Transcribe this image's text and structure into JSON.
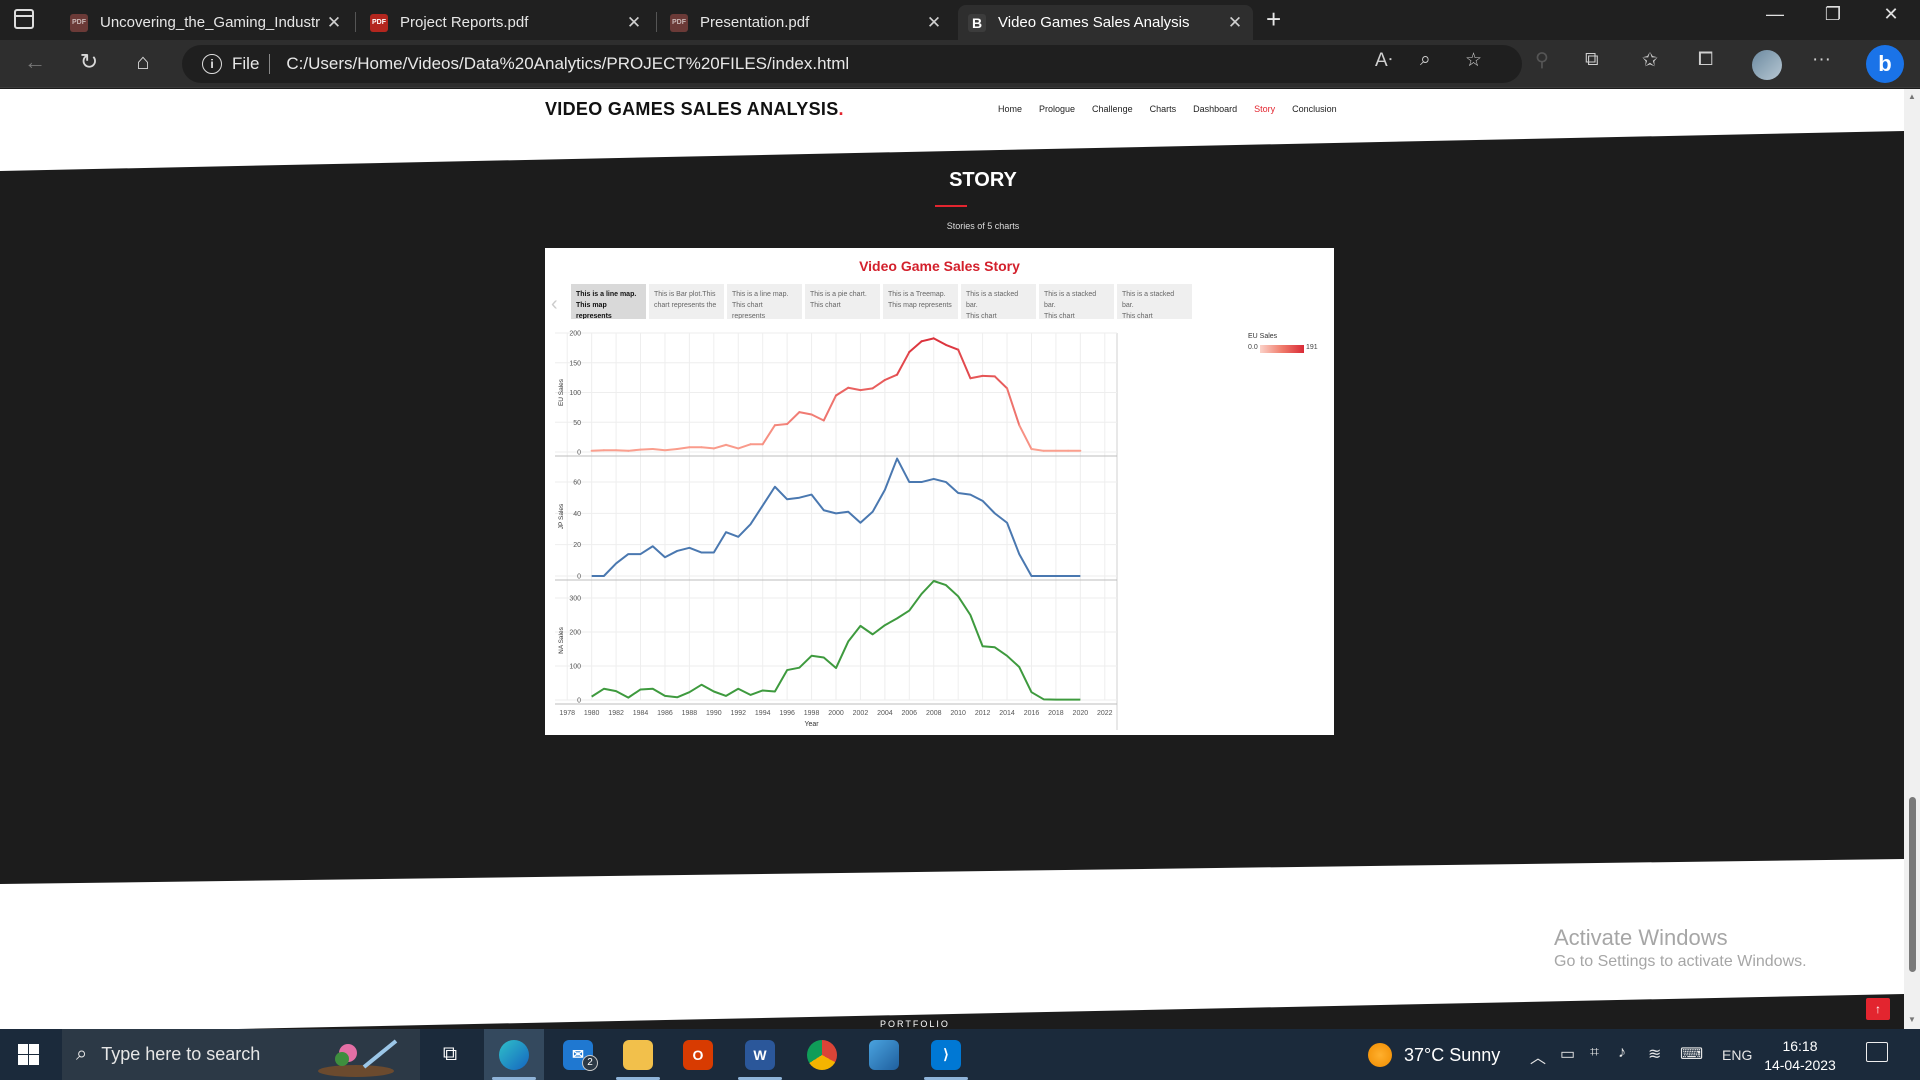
{
  "browser": {
    "tabs": [
      {
        "title": "Uncovering_the_Gaming_Industry",
        "icon": "pdf-icon"
      },
      {
        "title": "Project Reports.pdf",
        "icon": "pdf-icon"
      },
      {
        "title": "Presentation.pdf",
        "icon": "pdf-icon"
      },
      {
        "title": "Video Games Sales Analysis",
        "icon": "b-icon",
        "active": true
      }
    ],
    "new_tab_label": "+",
    "address_prefix": "File",
    "url": "C:/Users/Home/Videos/Data%20Analytics/PROJECT%20FILES/index.html",
    "bing_label": "b"
  },
  "site": {
    "brand": "VIDEO GAMES SALES ANALYSIS",
    "brand_dot": ".",
    "nav": [
      "Home",
      "Prologue",
      "Challenge",
      "Charts",
      "Dashboard",
      "Story",
      "Conclusion"
    ],
    "active_nav": "Story",
    "section_title": "STORY",
    "section_subtitle": "Stories of 5 charts",
    "footer_peek": "PORTFOLIO",
    "accent_color": "#e3252f"
  },
  "story": {
    "title": "Video Game Sales Story",
    "points": [
      {
        "line1": "This is a line map.",
        "line2": "This map represents",
        "active": true
      },
      {
        "line1": "This is Bar plot.This",
        "line2": "chart represents the"
      },
      {
        "line1": "This is a line map.",
        "line2": "This chart represents"
      },
      {
        "line1": "This is a pie chart.",
        "line2": "This chart"
      },
      {
        "line1": "This is a Treemap.",
        "line2": "This map represents"
      },
      {
        "line1": "This is a stacked bar.",
        "line2": "This chart"
      },
      {
        "line1": "This is a stacked bar.",
        "line2": "This chart"
      },
      {
        "line1": "This is a stacked bar.",
        "line2": "This chart represents"
      }
    ],
    "legend": {
      "title": "EU Sales",
      "min": "0.0",
      "max": "191"
    }
  },
  "chart_data": {
    "type": "line",
    "xlabel": "Year",
    "x": [
      1980,
      1981,
      1982,
      1983,
      1984,
      1985,
      1986,
      1987,
      1988,
      1989,
      1990,
      1991,
      1992,
      1993,
      1994,
      1995,
      1996,
      1997,
      1998,
      1999,
      2000,
      2001,
      2002,
      2003,
      2004,
      2005,
      2006,
      2007,
      2008,
      2009,
      2010,
      2011,
      2012,
      2013,
      2014,
      2015,
      2016,
      2017,
      2018,
      2019,
      2020
    ],
    "x_ticks": [
      1978,
      1980,
      1982,
      1984,
      1986,
      1988,
      1990,
      1992,
      1994,
      1996,
      1998,
      2000,
      2002,
      2004,
      2006,
      2008,
      2010,
      2012,
      2014,
      2016,
      2018,
      2020,
      2022
    ],
    "xlim": [
      1977,
      2023
    ],
    "panels": [
      {
        "name": "EU Sales",
        "ylabel": "EU Sales",
        "color": "#e0303a",
        "ylim": [
          0,
          200
        ],
        "yticks": [
          0,
          50,
          100,
          150,
          200
        ],
        "values": [
          2,
          3,
          3,
          2,
          4,
          5,
          3,
          5,
          8,
          8,
          6,
          12,
          6,
          13,
          13,
          45,
          47,
          67,
          63,
          53,
          95,
          108,
          104,
          107,
          121,
          130,
          168,
          186,
          191,
          180,
          172,
          124,
          128,
          127,
          107,
          45,
          5,
          2,
          2,
          2,
          2
        ]
      },
      {
        "name": "JP Sales",
        "ylabel": "JP Sales",
        "color": "#4a78b0",
        "ylim": [
          0,
          76
        ],
        "yticks": [
          0,
          20,
          40,
          60
        ],
        "values": [
          0,
          0,
          8,
          14,
          14,
          19,
          12,
          16,
          18,
          15,
          15,
          28,
          25,
          33,
          45,
          57,
          49,
          50,
          52,
          42,
          40,
          41,
          34,
          41,
          55,
          75,
          60,
          60,
          62,
          60,
          53,
          52,
          48,
          40,
          34,
          14,
          0,
          0,
          0,
          0,
          0
        ]
      },
      {
        "name": "NA Sales",
        "ylabel": "NA Sales",
        "color": "#3e9a3e",
        "ylim": [
          0,
          350
        ],
        "yticks": [
          0,
          100,
          200,
          300
        ],
        "values": [
          10,
          33,
          26,
          7,
          31,
          33,
          12,
          8,
          23,
          45,
          25,
          12,
          33,
          15,
          28,
          25,
          88,
          95,
          130,
          125,
          94,
          172,
          218,
          193,
          220,
          240,
          263,
          312,
          350,
          338,
          305,
          250,
          158,
          155,
          130,
          97,
          23,
          2,
          1,
          1,
          1
        ]
      }
    ]
  },
  "overlay": {
    "activate_line1": "Activate Windows",
    "activate_line2": "Go to Settings to activate Windows."
  },
  "taskbar": {
    "search_placeholder": "Type here to search",
    "mail_badge": "2",
    "weather": "37°C  Sunny",
    "language": "ENG",
    "time": "16:18",
    "date": "14-04-2023"
  }
}
